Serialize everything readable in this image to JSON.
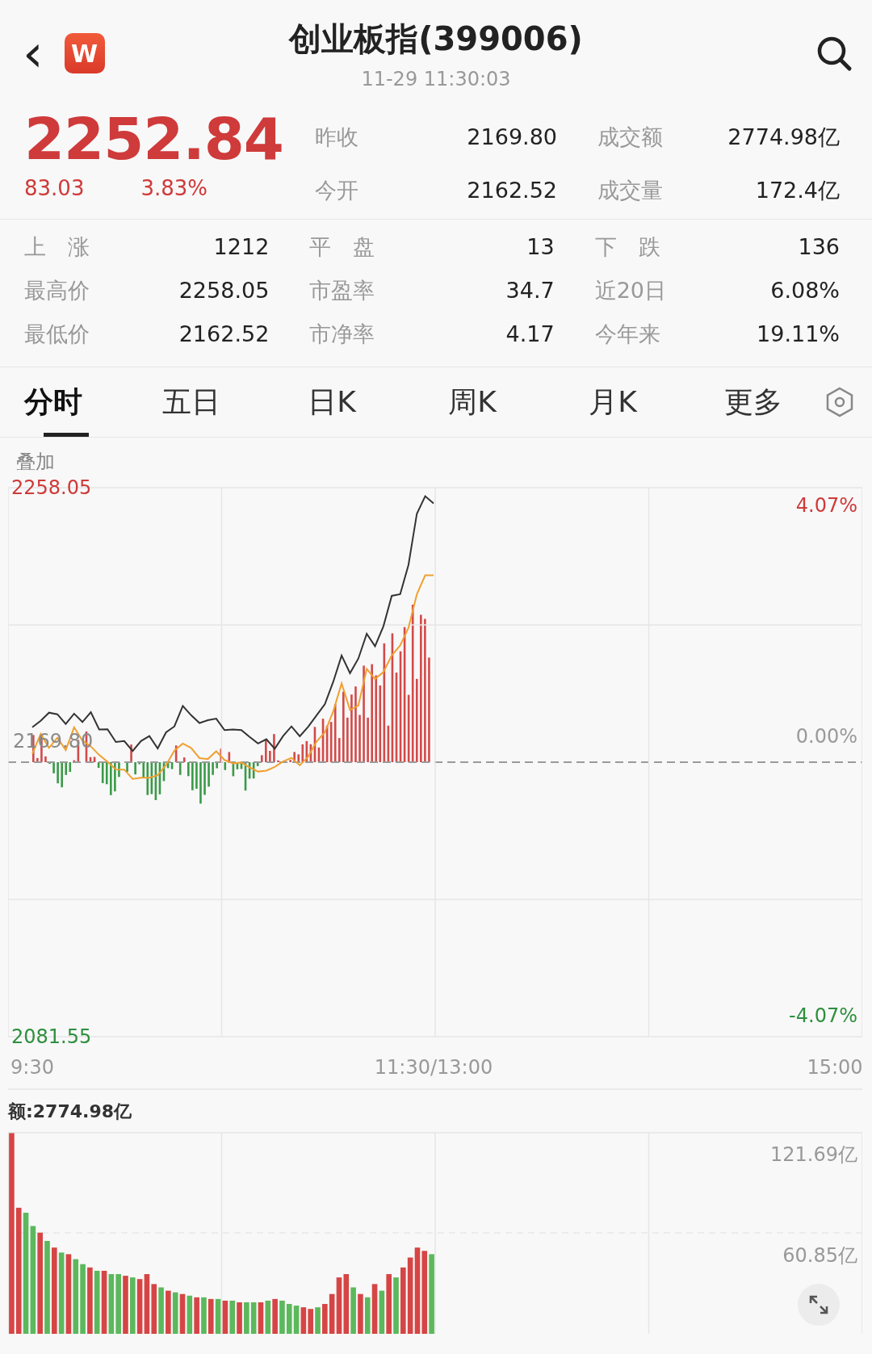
{
  "header": {
    "back": "‹",
    "logo_text": "W",
    "title": "创业板指(399006)",
    "time": "11-29 11:30:03"
  },
  "quote": {
    "last": "2252.84",
    "change": "83.03",
    "change_pct": "3.83%"
  },
  "stats_top": [
    {
      "label": "昨收",
      "value": "2169.80"
    },
    {
      "label": "成交额",
      "value": "2774.98亿"
    },
    {
      "label": "今开",
      "value": "2162.52"
    },
    {
      "label": "成交量",
      "value": "172.4亿"
    }
  ],
  "stats": [
    {
      "label": "上　涨",
      "value": "1212"
    },
    {
      "label": "平　盘",
      "value": "13"
    },
    {
      "label": "下　跌",
      "value": "136"
    },
    {
      "label": "最高价",
      "value": "2258.05"
    },
    {
      "label": "市盈率",
      "value": "34.7"
    },
    {
      "label": "近20日",
      "value": "6.08%"
    },
    {
      "label": "最低价",
      "value": "2162.52"
    },
    {
      "label": "市净率",
      "value": "4.17"
    },
    {
      "label": "今年来",
      "value": "19.11%"
    }
  ],
  "tabs": [
    {
      "label": "分时",
      "selected": true
    },
    {
      "label": "五日",
      "selected": false
    },
    {
      "label": "日K",
      "selected": false
    },
    {
      "label": "周K",
      "selected": false
    },
    {
      "label": "月K",
      "selected": false
    },
    {
      "label": "更多",
      "selected": false
    }
  ],
  "overlay_label": "叠加",
  "price_chart": {
    "base_label": "2169.80",
    "right_labels": [
      {
        "text": "4.07%",
        "color": "#cf3a3a"
      },
      {
        "text": "0.00%",
        "color": "#9a9a9a"
      },
      {
        "text": "-4.07%",
        "color": "#2f8f3f"
      }
    ],
    "chart_data": {
      "type": "line",
      "ylim": [
        2081.55,
        2258.05
      ],
      "yticks": [
        {
          "value": 2258.05,
          "label": "2258.05"
        },
        {
          "value": 2081.55,
          "label": "2081.55"
        }
      ],
      "categories": [
        "9:30",
        null,
        null,
        null,
        null,
        null,
        null,
        null,
        null,
        null,
        null,
        null,
        null,
        null,
        null,
        null,
        null,
        null,
        null,
        null,
        null,
        null,
        null,
        null,
        null,
        null,
        null,
        null,
        null,
        null,
        null,
        null,
        null,
        null,
        null,
        null,
        null,
        null,
        null,
        null,
        null,
        null,
        null,
        null,
        null,
        null,
        null,
        null,
        "11:30/13:00",
        null,
        null,
        null,
        null,
        null,
        null,
        null,
        null,
        null,
        null,
        null,
        null,
        null,
        null,
        null,
        null,
        null,
        null,
        null,
        null,
        null,
        null,
        null,
        null,
        null,
        null,
        null,
        null,
        null,
        null,
        null,
        null,
        null,
        null,
        null,
        null,
        null,
        null,
        null,
        null,
        null,
        null,
        null,
        null,
        null,
        null,
        null,
        "15:00"
      ],
      "series": [
        {
          "color": "#333333",
          "values": [
            2181,
            2183.1,
            2185.7,
            2185.2,
            2182.1,
            2185.4,
            2182.7,
            2185.9,
            2180.3,
            2180.4,
            2176.3,
            2176.6,
            2173.4,
            2176.6,
            2178.2,
            2174.2,
            2179.4,
            2181.3,
            2187.9,
            2184.9,
            2182.4,
            2183.3,
            2183.8,
            2180.1,
            2180.3,
            2180.1,
            2177.9,
            2175.8,
            2177.2,
            2174.1,
            2178.2,
            2181.3,
            2178.1,
            2181.2,
            2184.8,
            2188.5,
            2195.7,
            2204.1,
            2198.4,
            2203.1,
            2211.1,
            2207.1,
            2213.5,
            2223.3,
            2223.8,
            2233.2,
            2249.7,
            2255.3,
            2253,
            null,
            null,
            null,
            null,
            null,
            null,
            null,
            null,
            null,
            null,
            null,
            null,
            null,
            null,
            null,
            null,
            null,
            null,
            null,
            null,
            null,
            null,
            null,
            null,
            null,
            null,
            null,
            null,
            null,
            null,
            null,
            null,
            null,
            null,
            null,
            null,
            null,
            null,
            null,
            null,
            null,
            null,
            null,
            null,
            null,
            null,
            null,
            null
          ]
        },
        {
          "color": "#f0a030",
          "values": [
            2172.5,
            2178.9,
            2174.4,
            2177.7,
            2173.7,
            2181,
            2176.7,
            2174.9,
            2172.1,
            2169.9,
            2167.5,
            2167.4,
            2164.4,
            2164.8,
            2164.8,
            2165.6,
            2168.9,
            2173.5,
            2175.8,
            2174.4,
            2171.1,
            2170.8,
            2173.3,
            2170.5,
            2169.4,
            2169.7,
            2168.1,
            2166.8,
            2167.1,
            2168.3,
            2170,
            2171.2,
            2168.8,
            2171.6,
            2176.4,
            2179.4,
            2186.2,
            2195.1,
            2186.6,
            2188,
            2199.8,
            2196.5,
            2198.8,
            2204.1,
            2207.3,
            2213,
            2223.8,
            2229.9,
            2229.9,
            null,
            null,
            null,
            null,
            null,
            null,
            null,
            null,
            null,
            null,
            null,
            null,
            null,
            null,
            null,
            null,
            null,
            null,
            null,
            null,
            null,
            null,
            null,
            null,
            null,
            null,
            null,
            null,
            null,
            null,
            null,
            null,
            null,
            null,
            null,
            null,
            null,
            null,
            null,
            null,
            null,
            null,
            null,
            null,
            null,
            null,
            null,
            null
          ]
        }
      ]
    }
  },
  "volume_chart": {
    "label": "额:2774.98亿",
    "chart_data": {
      "type": "bar",
      "stacked": true,
      "ylim": [
        0,
        121.69
      ],
      "yticks": [
        {
          "value": 121.69,
          "label": "121.69亿"
        },
        {
          "value": 60.85,
          "label": "60.85亿"
        }
      ],
      "categories": [
        null,
        null,
        null,
        null,
        null,
        null,
        null,
        null,
        null,
        null,
        null,
        null,
        null,
        null,
        null,
        null,
        null,
        null,
        null,
        null,
        null,
        null,
        null,
        null,
        null,
        null,
        null,
        null,
        null,
        null,
        null,
        null,
        null,
        null,
        null,
        null,
        null,
        null,
        null,
        null,
        null,
        null,
        null,
        null,
        null,
        null,
        null,
        null,
        null,
        null,
        null,
        null,
        null,
        null,
        null,
        null,
        null,
        null,
        null,
        null,
        null,
        null,
        null,
        null,
        null,
        null,
        null,
        null,
        null,
        null,
        null,
        null,
        null,
        null,
        null,
        null,
        null,
        null,
        null,
        null,
        null,
        null,
        null,
        null,
        null,
        null,
        null,
        null,
        null,
        null,
        null,
        null,
        null,
        null,
        null,
        null,
        null,
        null,
        null,
        null,
        null,
        null,
        null,
        null,
        null,
        null,
        null,
        null,
        null,
        null,
        null,
        null,
        null,
        null,
        null,
        null,
        null,
        null,
        null,
        null
      ],
      "series": [
        {
          "color": "#d64545",
          "values": [
            121,
            76,
            null,
            null,
            61,
            null,
            52,
            null,
            48,
            null,
            null,
            40,
            null,
            38,
            null,
            null,
            35,
            null,
            33,
            36,
            30,
            null,
            26,
            null,
            24,
            null,
            22,
            null,
            21,
            null,
            20,
            null,
            19,
            null,
            null,
            19,
            null,
            21,
            null,
            null,
            null,
            16,
            15,
            null,
            18,
            24,
            34,
            36,
            null,
            24,
            null,
            30,
            null,
            36,
            null,
            40,
            46,
            52,
            50,
            null,
            null,
            null,
            null,
            null,
            null,
            null,
            null,
            null,
            null,
            null,
            null,
            null,
            null,
            null,
            null,
            null,
            null,
            null,
            null,
            null,
            null,
            null,
            null,
            null,
            null,
            null,
            null,
            null,
            null,
            null,
            null,
            null,
            null,
            null,
            null,
            null,
            null,
            null,
            null,
            null,
            null,
            null,
            null,
            null,
            null,
            null,
            null,
            null,
            null,
            null,
            null,
            null,
            null,
            null,
            null,
            null,
            null,
            null,
            null,
            null
          ]
        },
        {
          "color": "#5cb85c",
          "values": [
            null,
            null,
            73,
            65,
            null,
            56,
            null,
            49,
            null,
            45,
            42,
            null,
            38,
            null,
            36,
            36,
            null,
            34,
            null,
            null,
            null,
            28,
            null,
            25,
            null,
            23,
            null,
            22,
            null,
            21,
            null,
            20,
            null,
            19,
            19,
            null,
            20,
            null,
            20,
            18,
            17,
            null,
            null,
            16,
            null,
            null,
            null,
            null,
            28,
            null,
            22,
            null,
            26,
            null,
            34,
            null,
            null,
            null,
            null,
            48,
            null,
            null,
            null,
            null,
            null,
            null,
            null,
            null,
            null,
            null,
            null,
            null,
            null,
            null,
            null,
            null,
            null,
            null,
            null,
            null,
            null,
            null,
            null,
            null,
            null,
            null,
            null,
            null,
            null,
            null,
            null,
            null,
            null,
            null,
            null,
            null,
            null,
            null,
            null,
            null,
            null,
            null,
            null,
            null,
            null,
            null,
            null,
            null,
            null,
            null,
            null,
            null,
            null,
            null,
            null,
            null,
            null,
            null,
            null,
            null
          ]
        }
      ]
    }
  }
}
